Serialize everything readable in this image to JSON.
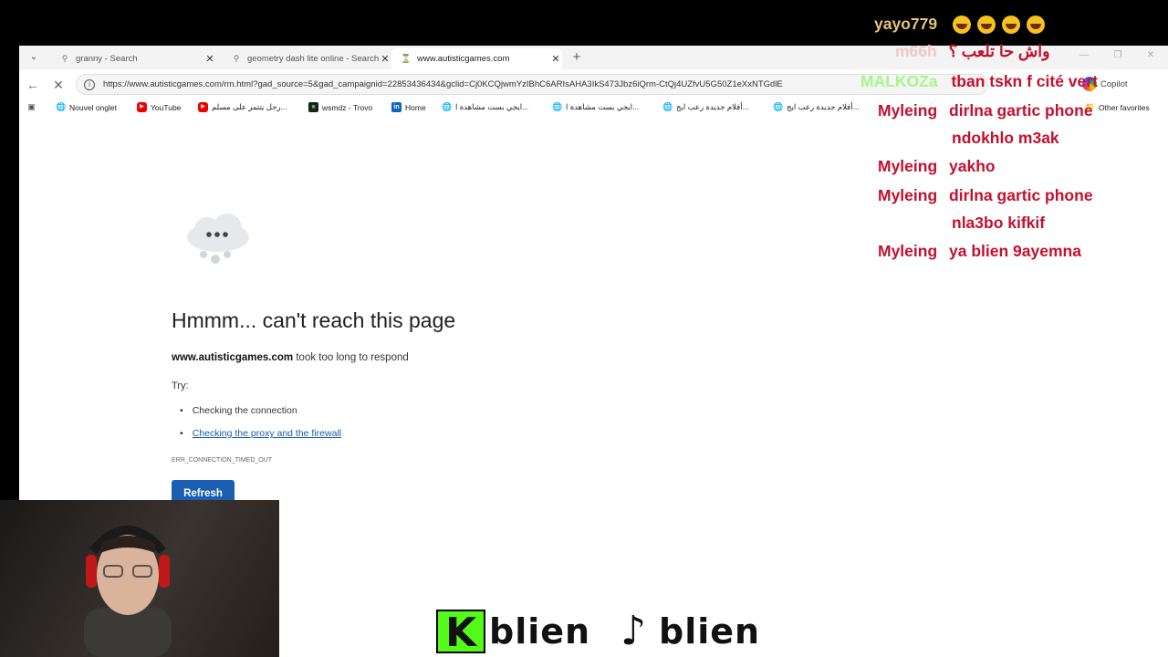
{
  "tabs": [
    {
      "title": "granny - Search",
      "icon": "search-icon"
    },
    {
      "title": "geometry dash lite online - Search",
      "icon": "search-icon"
    },
    {
      "title": "www.autisticgames.com",
      "icon": "loading-icon",
      "active": true
    }
  ],
  "address": {
    "url": "https://www.autisticgames.com/rm.html?gad_source=5&gad_campaignid=22853436434&gclid=Cj0KCQjwmYzIBhC6ARIsAHA3IkS473Jbz6iQrm-CtQj4UZfvU5G50Z1eXxNTGdlE"
  },
  "toolbar": {
    "copilot_label": "Copilot"
  },
  "bookmarks": [
    {
      "label": "Nouvel onglet",
      "icon": "globe"
    },
    {
      "label": "YouTube",
      "icon": "youtube"
    },
    {
      "label": "رجل يتتمر على مسلم...",
      "icon": "youtube"
    },
    {
      "label": "wsmdz - Trovo",
      "icon": "trovo"
    },
    {
      "label": "Home",
      "icon": "linkedin"
    },
    {
      "label": "ايجي بست مشاهدة ا...",
      "icon": "globe"
    },
    {
      "label": "ايجي بست مشاهدة ا...",
      "icon": "globe"
    },
    {
      "label": "أفلام جديدة رعب ايج...",
      "icon": "globe"
    },
    {
      "label": "أفلام جديدة رعب ايج...",
      "icon": "globe"
    }
  ],
  "other_favorites": "Other favorites",
  "error": {
    "title": "Hmmm... can't reach this page",
    "host": "www.autisticgames.com",
    "message": "took too long to respond",
    "try_label": "Try:",
    "suggestions": [
      "Checking the connection",
      "Checking the proxy and the firewall"
    ],
    "code": "ERR_CONNECTION_TIMED_OUT",
    "refresh_label": "Refresh"
  },
  "chat": [
    {
      "user": "yayo779",
      "message": "",
      "emojis": 4,
      "user_color": "#e6c27a"
    },
    {
      "user": "m66h",
      "message": "واش حا تلعب ؟",
      "user_color": "#f1c6c6",
      "msg_color": "#c4102e"
    },
    {
      "user": "MALKOZa",
      "message": "tban tskn f cité vert",
      "user_color": "#a5f58a",
      "msg_color": "#c4102e"
    },
    {
      "user": "Myleing",
      "message": "dirlna gartic phone",
      "user_color": "#c4102e",
      "msg_color": "#c4102e"
    },
    {
      "user": "",
      "message": "ndokhlo m3ak",
      "user_color": "#c4102e",
      "msg_color": "#c4102e"
    },
    {
      "user": "Myleing",
      "message": "yakho",
      "user_color": "#c4102e",
      "msg_color": "#c4102e"
    },
    {
      "user": "Myleing",
      "message": "dirlna gartic phone",
      "user_color": "#c4102e",
      "msg_color": "#c4102e"
    },
    {
      "user": "",
      "message": "nla3bo kifkif",
      "user_color": "#c4102e",
      "msg_color": "#c4102e"
    },
    {
      "user": "Myleing",
      "message": "ya blien 9ayemna",
      "user_color": "#c4102e",
      "msg_color": "#c4102e"
    }
  ],
  "socials": [
    {
      "platform": "kick",
      "name": "blien"
    },
    {
      "platform": "tiktok",
      "name": "blien"
    }
  ]
}
